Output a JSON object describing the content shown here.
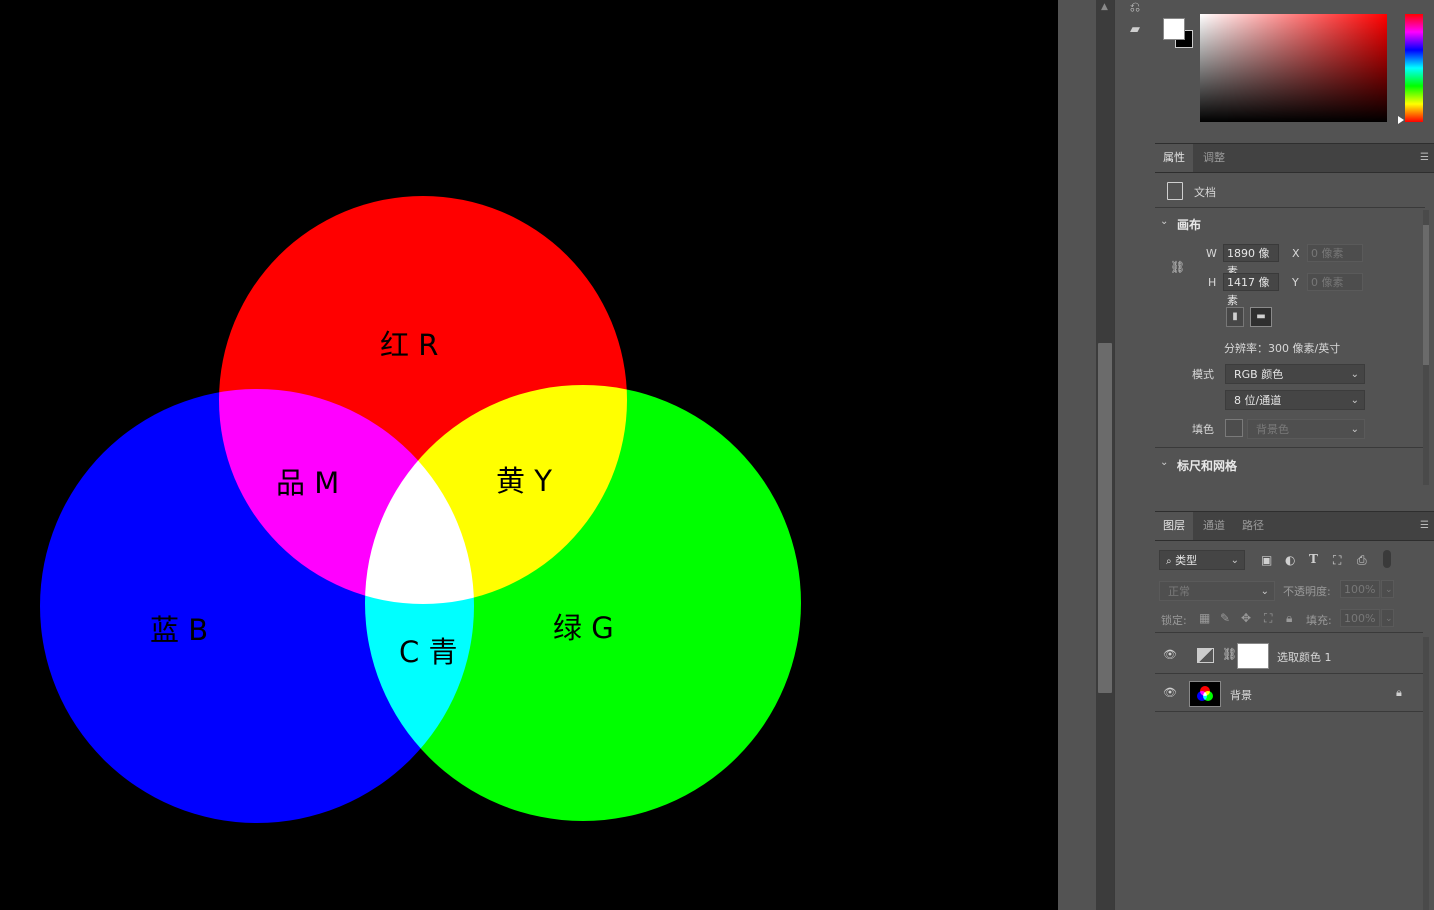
{
  "canvas": {
    "background": "#000000",
    "labels": {
      "red": "红 R",
      "magenta": "品 M",
      "yellow": "黄 Y",
      "blue": "蓝 B",
      "cyan": "C 青",
      "green": "绿 G"
    },
    "colors": {
      "red": "#ff0000",
      "green": "#00ff00",
      "blue": "#0000ff"
    }
  },
  "color_picker": {
    "foreground": "#ffffff",
    "background": "#000000",
    "hue": "#ff0000"
  },
  "properties": {
    "tabs": [
      "属性",
      "调整"
    ],
    "doc_label": "文档",
    "canvas_section": "画布",
    "w_label": "W",
    "w_value": "1890 像素",
    "h_label": "H",
    "h_value": "1417 像素",
    "x_label": "X",
    "x_placeholder": "0 像素",
    "y_label": "Y",
    "y_placeholder": "0 像素",
    "resolution": "分辨率：300 像素/英寸",
    "mode_label": "模式",
    "mode_value": "RGB 颜色",
    "depth_value": "8 位/通道",
    "fill_label": "填色",
    "fill_value": "背景色",
    "rulers_section": "标尺和网格"
  },
  "layers": {
    "tabs": [
      "图层",
      "通道",
      "路径"
    ],
    "filter_kind": "类型",
    "blend_mode": "正常",
    "opacity_label": "不透明度:",
    "opacity_value": "100%",
    "lock_label": "锁定:",
    "fill_label": "填充:",
    "fill_value": "100%",
    "items": [
      {
        "name": "选取颜色 1"
      },
      {
        "name": "背景"
      }
    ]
  }
}
